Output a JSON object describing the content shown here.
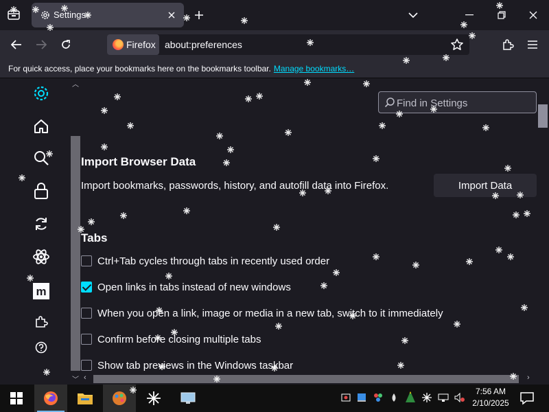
{
  "window": {
    "tab_title": "Settings",
    "identity_label": "Firefox",
    "url": "about:preferences"
  },
  "bookmarks_bar": {
    "message": "For quick access, place your bookmarks here on the bookmarks toolbar.",
    "link": "Manage bookmarks…"
  },
  "sidebar": {
    "categories": [
      {
        "name": "general",
        "icon": "gear-icon"
      },
      {
        "name": "home",
        "icon": "home-icon"
      },
      {
        "name": "search",
        "icon": "search-icon"
      },
      {
        "name": "privacy",
        "icon": "lock-icon"
      },
      {
        "name": "sync",
        "icon": "sync-icon"
      },
      {
        "name": "experimental",
        "icon": "atom-icon"
      },
      {
        "name": "more-from-mozilla",
        "icon": "mozilla-m-icon"
      },
      {
        "name": "extensions",
        "icon": "puzzle-icon"
      },
      {
        "name": "support",
        "icon": "help-icon"
      }
    ]
  },
  "search": {
    "placeholder": "Find in Settings"
  },
  "import_section": {
    "heading": "Import Browser Data",
    "description": "Import bookmarks, passwords, history, and autofill data into Firefox.",
    "button": "Import Data"
  },
  "tabs_section": {
    "heading": "Tabs",
    "options": [
      {
        "label": "Ctrl+Tab cycles through tabs in recently used order",
        "checked": false
      },
      {
        "label": "Open links in tabs instead of new windows",
        "checked": true
      },
      {
        "label": "When you open a link, image or media in a new tab, switch to it immediately",
        "checked": false
      },
      {
        "label": "Confirm before closing multiple tabs",
        "checked": false
      },
      {
        "label": "Show tab previews in the Windows taskbar",
        "checked": false
      }
    ]
  },
  "taskbar": {
    "apps": [
      "firefox",
      "file-explorer",
      "paint-app",
      "snipping-tool",
      "control-panel"
    ],
    "time": "7:56 AM",
    "date": "2/10/2025"
  },
  "colors": {
    "accent": "#00ddff",
    "background": "#1c1b22",
    "toolbar": "#2b2a33"
  }
}
